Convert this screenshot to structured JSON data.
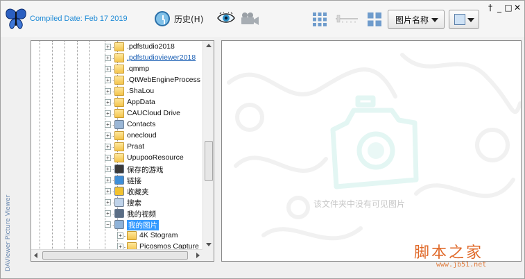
{
  "toolbar": {
    "compiled": "Compiled Date: Feb 17 2019",
    "history_label": "历史(H)",
    "sort_label": "图片名称"
  },
  "window_controls": [
    "†",
    "_",
    "□",
    "✕"
  ],
  "side_label": "DAViewer Picture Viewer",
  "tree": {
    "items": [
      {
        "label": ".pdfstudio2018",
        "icon": "folder-icon",
        "style": "normal"
      },
      {
        "label": ".pdfstudioviewer2018",
        "icon": "folder-icon",
        "style": "link"
      },
      {
        "label": ".qmmp",
        "icon": "folder-icon",
        "style": "normal"
      },
      {
        "label": ".QtWebEngineProcess",
        "icon": "folder-icon",
        "style": "normal"
      },
      {
        "label": ".ShaLou",
        "icon": "folder-icon",
        "style": "normal"
      },
      {
        "label": "AppData",
        "icon": "folder-icon",
        "style": "normal"
      },
      {
        "label": "CAUCloud Drive",
        "icon": "folder-icon",
        "style": "normal"
      },
      {
        "label": "Contacts",
        "icon": "contacts-icon",
        "style": "normal"
      },
      {
        "label": "onecloud",
        "icon": "folder-icon",
        "style": "normal"
      },
      {
        "label": "Praat",
        "icon": "folder-icon",
        "style": "normal"
      },
      {
        "label": "UpupooResource",
        "icon": "folder-icon",
        "style": "normal"
      },
      {
        "label": "保存的游戏",
        "icon": "saved-games-icon",
        "style": "normal"
      },
      {
        "label": "链接",
        "icon": "links-icon",
        "style": "normal"
      },
      {
        "label": "收藏夹",
        "icon": "favorites-icon",
        "style": "normal"
      },
      {
        "label": "搜索",
        "icon": "search-icon",
        "style": "normal"
      },
      {
        "label": "我的视频",
        "icon": "videos-icon",
        "style": "normal"
      },
      {
        "label": "我的图片",
        "icon": "pictures-icon",
        "style": "selected"
      },
      {
        "label": "4K Stogram",
        "icon": "folder-icon",
        "style": "child"
      },
      {
        "label": "Picosmos Capture",
        "icon": "folder-icon",
        "style": "child"
      }
    ]
  },
  "content": {
    "empty_message": "该文件夹中没有可见图片"
  },
  "watermark": {
    "logo_text": "脚本之家",
    "url": "www.jb51.net"
  },
  "colors": {
    "accent": "#1e8ad6",
    "selection": "#3399ff",
    "watermark_orange": "#e06a2a"
  }
}
